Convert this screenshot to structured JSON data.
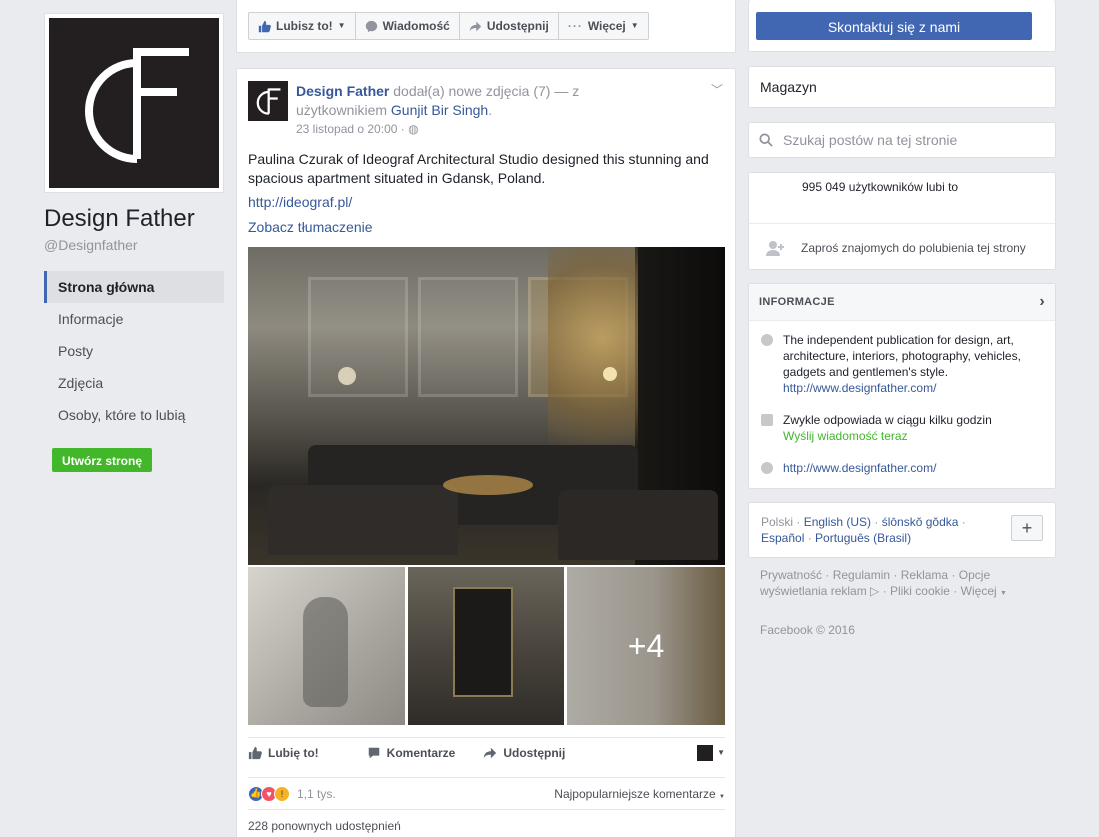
{
  "page": {
    "name": "Design Father",
    "handle": "@Designfather",
    "logo_letters": "dF"
  },
  "left_nav": {
    "items": [
      {
        "label": "Strona główna",
        "active": true
      },
      {
        "label": "Informacje"
      },
      {
        "label": "Posty"
      },
      {
        "label": "Zdjęcia"
      },
      {
        "label": "Osoby, które to lubią"
      }
    ],
    "create_page_label": "Utwórz stronę"
  },
  "actionbar": {
    "like_label": "Lubisz to!",
    "message_label": "Wiadomość",
    "share_label": "Udostępnij",
    "more_label": "Więcej"
  },
  "contact_button": "Skontaktuj się z nami",
  "post": {
    "author": "Design Father",
    "action_text": "dodał(a) nowe zdjęcia (7) — z użytkownikiem",
    "tagged_user": "Gunjit Bir Singh",
    "date": "23 listopad o 20:00 ·",
    "text": "Paulina Czurak of Ideograf Architectural Studio designed this stunning and spacious apartment situated in Gdansk, Poland.",
    "link": "http://ideograf.pl/",
    "translate": "Zobacz tłumaczenie",
    "more_photos": "+4",
    "actions": {
      "like": "Lubię to!",
      "comment": "Komentarze",
      "share": "Udostępnij"
    },
    "reaction_count": "1,1 tys.",
    "sort_label": "Najpopularniejsze komentarze",
    "shares_text": "228 ponownych udostępnień"
  },
  "sidebar": {
    "category": "Magazyn",
    "search_placeholder": "Szukaj postów na tej stronie",
    "likes_text": "995 049 użytkowników lubi to",
    "invite_text": "Zaproś znajomych do polubienia tej strony",
    "info_header": "INFORMACJE",
    "description": "The independent publication for design, art, architecture, interiors, photography, vehicles, gadgets and gentlemen's style.",
    "description_link": "http://www.designfather.com/",
    "response_text": "Zwykle odpowiada w ciągu kilku godzin",
    "send_message": "Wyślij wiadomość teraz",
    "website": "http://www.designfather.com/",
    "languages": {
      "current": "Polski",
      "others": [
        "English (US)",
        "ślōnskŏ gŏdka",
        "Español",
        "Português (Brasil)"
      ]
    },
    "footer_links": [
      "Prywatność",
      "Regulamin",
      "Reklama",
      "Opcje wyświetlania reklam",
      "Pliki cookie",
      "Więcej"
    ],
    "copyright": "Facebook © 2016"
  },
  "colors": {
    "fb_blue": "#4267b2",
    "link": "#365899",
    "green": "#42b72a",
    "bg": "#e9ebee"
  }
}
